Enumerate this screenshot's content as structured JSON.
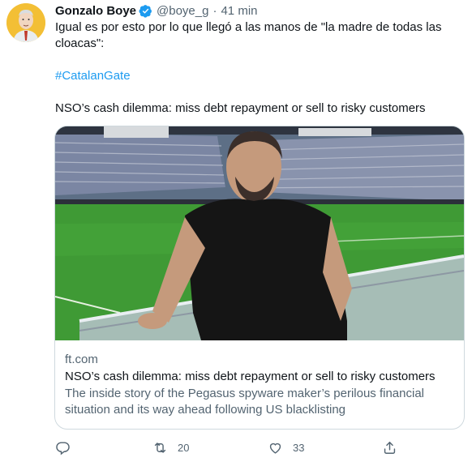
{
  "tweet": {
    "author_name": "Gonzalo Boye",
    "handle": "@boye_g",
    "separator": "·",
    "time": "41 min",
    "text_line1": "Igual es por esto por lo que llegó a las manos de \"la madre de todas las cloacas\":",
    "hashtag": "#CatalanGate",
    "headline": "NSO’s cash dilemma: miss debt repayment or sell to risky customers"
  },
  "card": {
    "domain": "ft.com",
    "title": "NSO’s cash dilemma: miss debt repayment or sell to risky customers",
    "description": "The inside story of the Pegasus spyware maker’s perilous financial situation and its way ahead following US blacklisting"
  },
  "actions": {
    "reply_count": "",
    "retweet_count": "20",
    "like_count": "33"
  },
  "colors": {
    "accent": "#1d9bf0",
    "secondary_text": "#536471",
    "border": "#cfd9de"
  },
  "icons": [
    "verified-badge-icon",
    "more-icon",
    "reply-icon",
    "retweet-icon",
    "like-icon",
    "share-icon"
  ]
}
